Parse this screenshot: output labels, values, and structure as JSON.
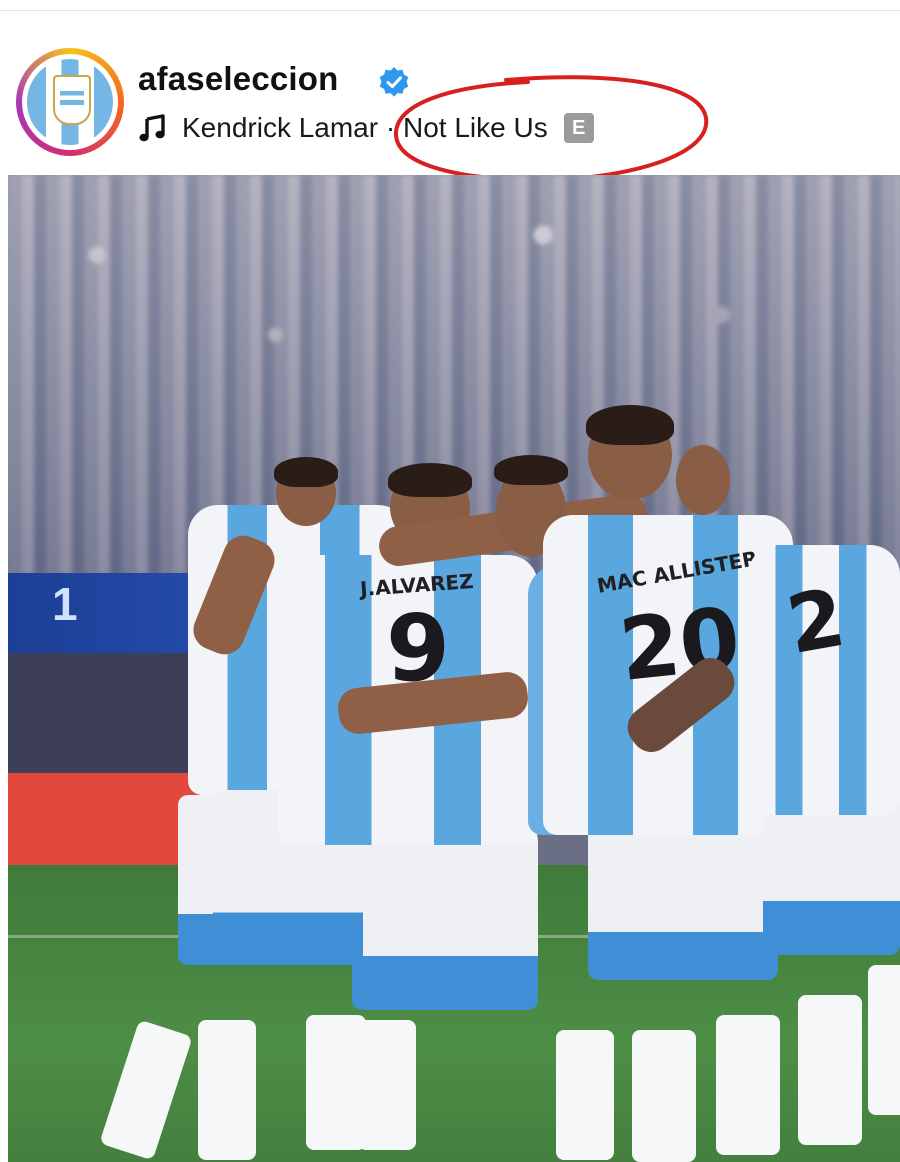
{
  "post": {
    "username": "afaseleccion",
    "verified": true,
    "music": {
      "artist": "Kendrick Lamar",
      "separator": " · ",
      "song": "Not Like Us",
      "explicit_badge": "E"
    },
    "icons": {
      "verified": "verified-badge-icon",
      "music": "music-note-icon"
    },
    "annotation_color": "#d8201f"
  },
  "photo": {
    "scoreboard_text": "1",
    "jerseys": [
      {
        "name": "J.ALVAREZ",
        "number": "9"
      },
      {
        "name": "MAC ALLISTER",
        "number": "20"
      },
      {
        "name": "",
        "number": "2"
      }
    ]
  }
}
